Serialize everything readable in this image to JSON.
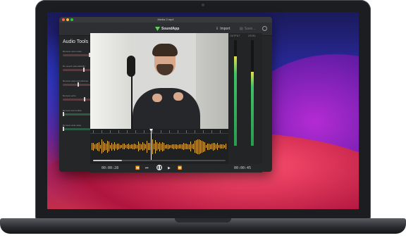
{
  "window": {
    "title": "Media 2.mp4"
  },
  "toolbar": {
    "app_name": "SoundApp",
    "import_label": "Import",
    "save_label": "Save..."
  },
  "sidebar": {
    "title": "Audio Tools",
    "tools": [
      {
        "label": "Remove room noise",
        "value": "",
        "level": 0.72,
        "accent": "#5a3b40"
      },
      {
        "label": "De-reverb automatically",
        "value": "",
        "level": 0.55,
        "accent": "#5a3b40"
      },
      {
        "label": "Remove pops and plosives",
        "value": "",
        "level": 0.4,
        "accent": "#5a3b40"
      },
      {
        "label": "Remove echo",
        "value": "",
        "level": 0.58,
        "accent": "#5a3b40"
      },
      {
        "label": "Remove low rumble",
        "value": "",
        "level": 0.0,
        "accent": "#2f5a43"
      },
      {
        "label": "Remove wind noise",
        "value": "",
        "level": 0.0,
        "accent": "#2f5a43"
      }
    ]
  },
  "meters": {
    "left_label": "OUTPUT",
    "right_label": "LEVEL",
    "left_level": 0.85,
    "right_level": 0.7
  },
  "transport": {
    "current_time": "00:00:28",
    "total_time": "00:00:45",
    "progress": 0.22,
    "icons": [
      "rewind-icon",
      "step-back-icon",
      "pause-icon",
      "step-forward-icon",
      "fast-forward-icon"
    ]
  },
  "colors": {
    "accent_green": "#5ed35c",
    "waveform": "#e8b53a"
  }
}
